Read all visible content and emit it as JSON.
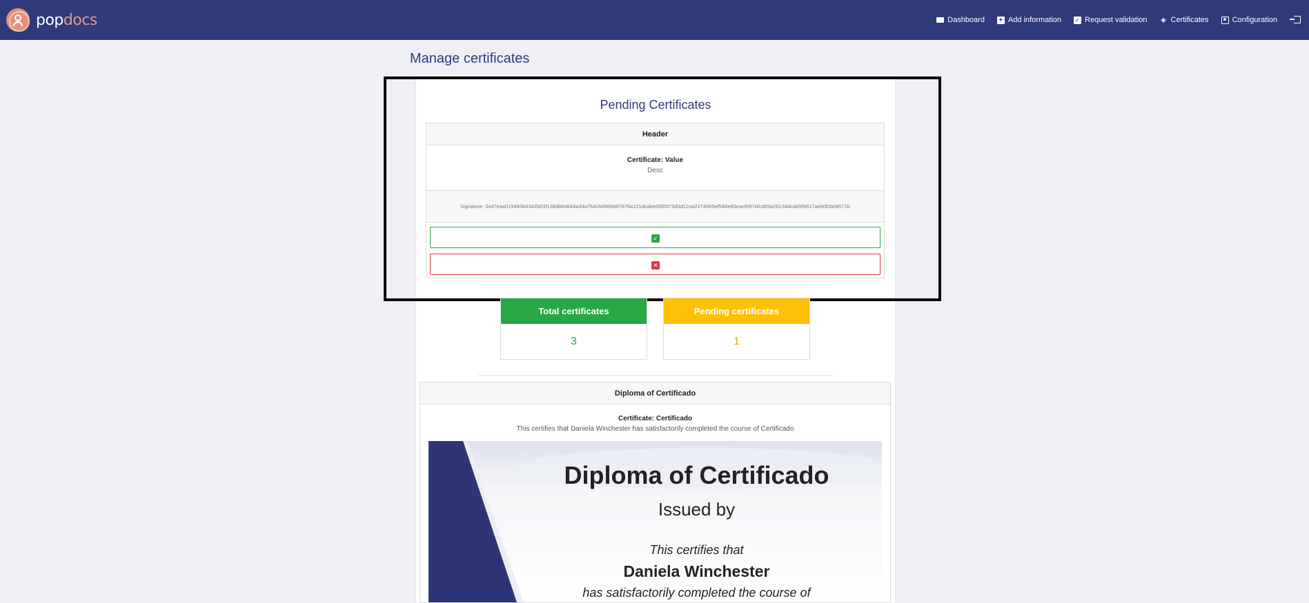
{
  "app": {
    "logo_pop": "pop",
    "logo_docs": "docs"
  },
  "nav": {
    "items": [
      {
        "label": "Dashboard",
        "icon": "dashboard-icon"
      },
      {
        "label": "Add information",
        "icon": "plus-icon"
      },
      {
        "label": "Request validation",
        "icon": "check-icon"
      },
      {
        "label": "Certificates",
        "icon": "layers-icon"
      },
      {
        "label": "Configuration",
        "icon": "user-icon"
      }
    ],
    "logout_icon": "logout-icon"
  },
  "page": {
    "title": "Manage certificates"
  },
  "pending": {
    "title": "Pending Certificates",
    "header": "Header",
    "cert_line": "Certificate: Value",
    "desc": "Desc",
    "signature": "Signature: 0xd7eaa015493b4342b03f138db84644a34a764c64569687676a121dcabe06f0573d3d12aa2274655ef546e65eacf097bfcd09a26134dcab5f9517aeb0fcb08571b",
    "accept_icon": "check-icon",
    "reject_icon": "close-icon"
  },
  "stats": {
    "total_label": "Total certificates",
    "total_value": "3",
    "pending_label": "Pending certificates",
    "pending_value": "1"
  },
  "diploma": {
    "header": "Diploma of Certificado",
    "cert_line": "Certificate: Certificado",
    "desc": "This certifies that Daniela Winchester has satisfactorily completed the course of Certificado",
    "image": {
      "title": "Diploma of Certificado",
      "issued_by": "Issued by",
      "certifies": "This certifies that",
      "name": "Daniela Winchester",
      "completed": "has satisfactorily completed the course of"
    },
    "prev_icon": "chevron-left-icon",
    "next_icon": "chevron-right-icon"
  },
  "colors": {
    "navbar": "#2e3a7c",
    "success": "#28a745",
    "danger": "#dc3545",
    "warning": "#ffc107",
    "logo_accent": "#e2917a"
  }
}
